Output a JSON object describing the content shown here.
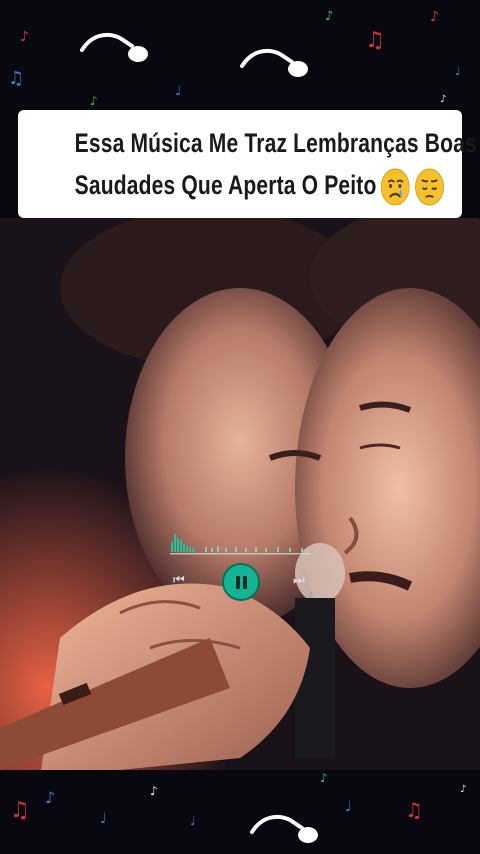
{
  "caption": {
    "line1": "Essa Música Me Traz Lembranças Boas",
    "line2": "Saudades Que Aperta O Peito"
  },
  "emojis": [
    "crying-face",
    "pensive-face"
  ],
  "player": {
    "state": "playing",
    "controls": [
      "previous",
      "pause",
      "next"
    ],
    "accent_color": "#13b493"
  },
  "decor": {
    "note_colors": [
      "#e23a3a",
      "#3a8ee2",
      "#4fd06a",
      "#f0c23a",
      "#ffffff"
    ]
  }
}
